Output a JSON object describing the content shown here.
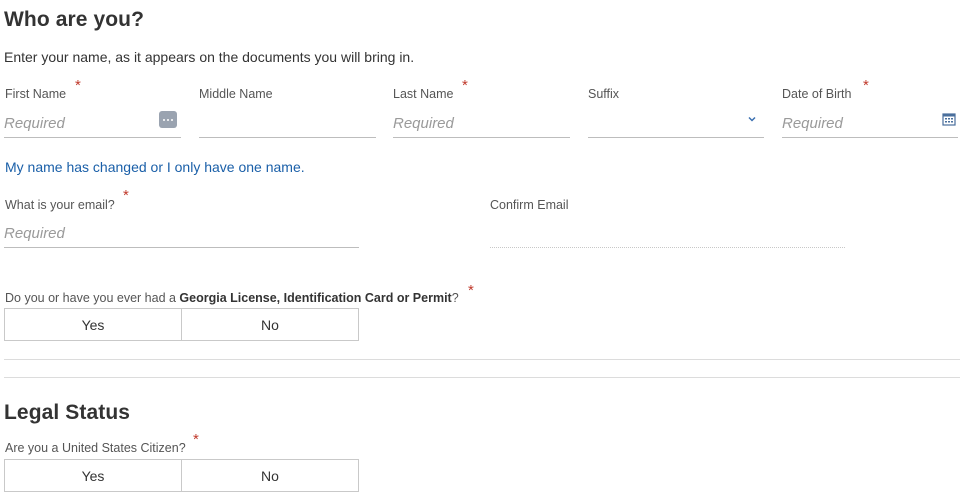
{
  "who": {
    "title": "Who are you?",
    "intro": "Enter your name, as it appears on the documents you will bring in.",
    "first_name": {
      "label": "First Name",
      "placeholder": "Required",
      "required": "*"
    },
    "middle_name": {
      "label": "Middle Name"
    },
    "last_name": {
      "label": "Last Name",
      "placeholder": "Required",
      "required": "*"
    },
    "suffix": {
      "label": "Suffix"
    },
    "dob": {
      "label": "Date of Birth",
      "placeholder": "Required",
      "required": "*"
    },
    "name_changed_link": "My name has changed or I only have one name.",
    "email": {
      "label": "What is your email?",
      "placeholder": "Required",
      "required": "*"
    },
    "confirm_email": {
      "label": "Confirm Email"
    },
    "license_question": {
      "prefix": "Do you or have you ever had a ",
      "bold": "Georgia License, Identification Card or Permit",
      "suffix": "?",
      "required": "*",
      "yes": "Yes",
      "no": "No"
    }
  },
  "legal": {
    "title": "Legal Status",
    "citizen_question": "Are you a United States Citizen?",
    "required": "*",
    "yes": "Yes",
    "no": "No"
  },
  "icons": {
    "more": "more-options-icon",
    "chevron": "chevron-down-icon",
    "calendar": "calendar-icon"
  },
  "colors": {
    "link": "#1a5fa8",
    "required_star": "#c0392b"
  }
}
